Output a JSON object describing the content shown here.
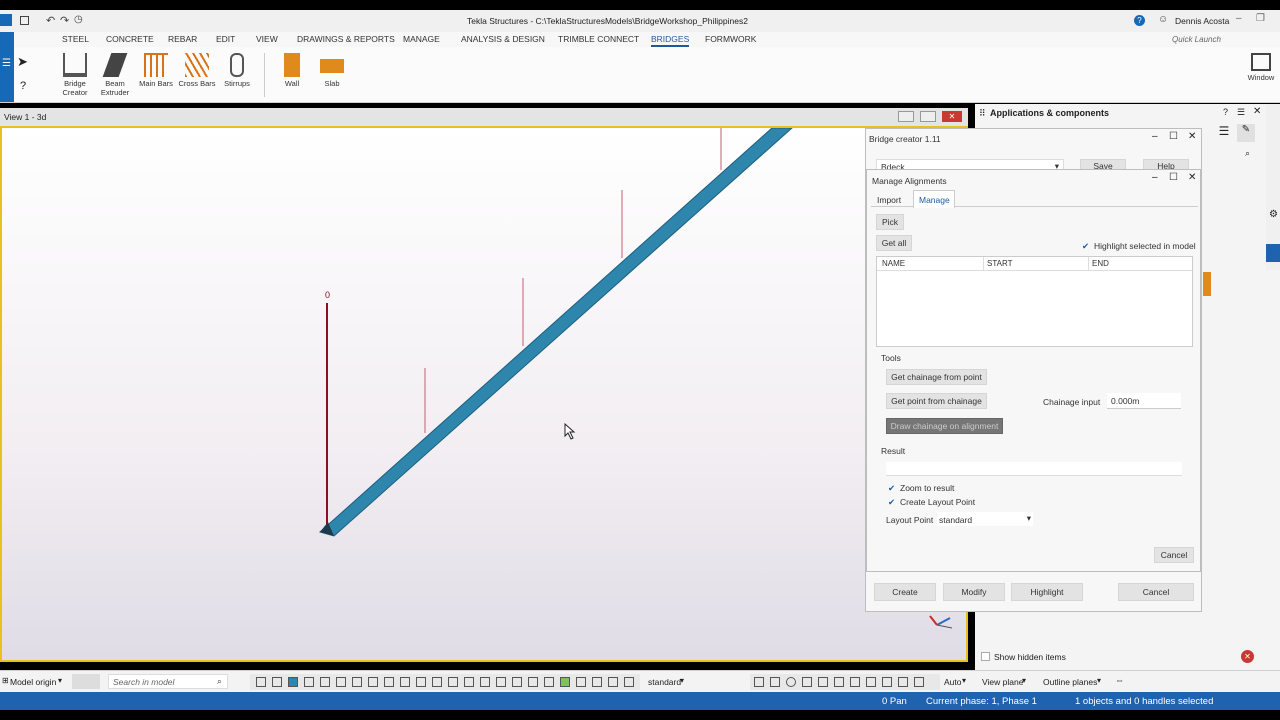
{
  "title": "Tekla Structures - C:\\TeklaStructuresModels\\BridgeWorkshop_Philippines2",
  "user": "Dennis Acosta",
  "quick_launch": "Quick Launch",
  "menu": [
    "STEEL",
    "CONCRETE",
    "REBAR",
    "EDIT",
    "VIEW",
    "DRAWINGS & REPORTS",
    "MANAGE",
    "ANALYSIS & DESIGN",
    "TRIMBLE CONNECT",
    "BRIDGES",
    "FORMWORK"
  ],
  "ribbon": {
    "bridge_creator": "Bridge Creator",
    "beam_extruder": "Beam Extruder",
    "main_bars": "Main Bars",
    "cross_bars": "Cross Bars",
    "stirrups": "Stirrups",
    "wall": "Wall",
    "slab": "Slab",
    "window": "Window"
  },
  "view": {
    "title": "View 1 - 3d",
    "marker": "0"
  },
  "apps_panel": {
    "title": "Applications & components",
    "show_hidden": "Show hidden items"
  },
  "bridge_creator": {
    "title": "Bridge creator 1.11",
    "dropdown": "Bdeck",
    "save": "Save",
    "help": "Help",
    "create": "Create",
    "modify": "Modify",
    "highlight": "Highlight",
    "cancel": "Cancel"
  },
  "manage_alignments": {
    "title": "Manage Alignments",
    "tab_import": "Import",
    "tab_manage": "Manage",
    "pick": "Pick",
    "get_all": "Get all",
    "highlight_selected": "Highlight selected in model",
    "columns": [
      "NAME",
      "START",
      "END"
    ],
    "tools_label": "Tools",
    "get_chainage": "Get chainage from point",
    "get_point": "Get point from chainage",
    "draw_chainage": "Draw chainage on alignment",
    "chainage_input_label": "Chainage input",
    "chainage_input_value": "0.000m",
    "result_label": "Result",
    "zoom_to_result": "Zoom to result",
    "create_layout_point": "Create Layout Point",
    "layout_point_label": "Layout Point",
    "layout_point_value": "standard",
    "cancel": "Cancel"
  },
  "bottom_toolbar": {
    "model_origin": "Model origin",
    "search_placeholder": "Search in model",
    "standard": "standard",
    "auto": "Auto",
    "view_plane": "View plane",
    "outline_planes": "Outline planes"
  },
  "status": {
    "pan": "0 Pan",
    "phase": "Current phase: 1, Phase 1",
    "selection": "1 objects and 0 handles selected"
  },
  "colors": {
    "accent": "#1f62b0",
    "beam": "#2f86ad",
    "viewport_border": "#e8c020"
  }
}
